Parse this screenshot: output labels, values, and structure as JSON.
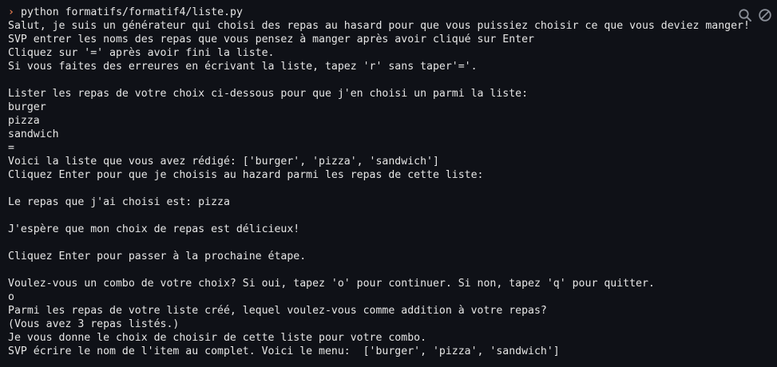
{
  "terminal": {
    "prompt_symbol": "›",
    "command": "python formatifs/formatif4/liste.py",
    "lines": [
      "Salut, je suis un générateur qui choisi des repas au hasard pour que vous puissiez choisir ce que vous deviez manger!",
      "SVP entrer les noms des repas que vous pensez à manger après avoir cliqué sur Enter",
      "Cliquez sur '=' après avoir fini la liste.",
      "Si vous faites des erreures en écrivant la liste, tapez 'r' sans taper'='.",
      "",
      "Lister les repas de votre choix ci-dessous pour que j'en choisi un parmi la liste:",
      "burger",
      "pizza",
      "sandwich",
      "=",
      "Voici la liste que vous avez rédigé: ['burger', 'pizza', 'sandwich']",
      "Cliquez Enter pour que je choisis au hazard parmi les repas de cette liste:",
      "",
      "Le repas que j'ai choisi est: pizza",
      "",
      "J'espère que mon choix de repas est délicieux!",
      "",
      "Cliquez Enter pour passer à la prochaine étape.",
      "",
      "Voulez-vous un combo de votre choix? Si oui, tapez 'o' pour continuer. Si non, tapez 'q' pour quitter.",
      "o",
      "Parmi les repas de votre liste créé, lequel voulez-vous comme addition à votre repas?",
      "(Vous avez 3 repas listés.)",
      "Je vous donne le choix de choisir de cette liste pour votre combo.",
      "SVP écrire le nom de l'item au complet. Voici le menu:  ['burger', 'pizza', 'sandwich']"
    ]
  },
  "icons": {
    "search": "search-icon",
    "clear": "clear-icon"
  },
  "colors": {
    "background": "#0f1117",
    "text": "#e6e6e6",
    "prompt": "#e07a4f",
    "icon": "#8a8f98"
  }
}
